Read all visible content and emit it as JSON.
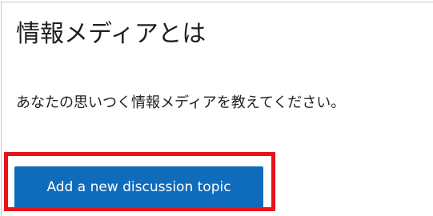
{
  "discussion": {
    "title": "情報メディアとは",
    "prompt": "あなたの思いつく情報メディアを教えてください。"
  },
  "actions": {
    "add_topic_label": "Add a new discussion topic"
  },
  "colors": {
    "button_background": "#0f6cbd",
    "button_text": "#ffffff",
    "highlight_border": "#e8121e",
    "panel_border": "#c8c8c8"
  }
}
